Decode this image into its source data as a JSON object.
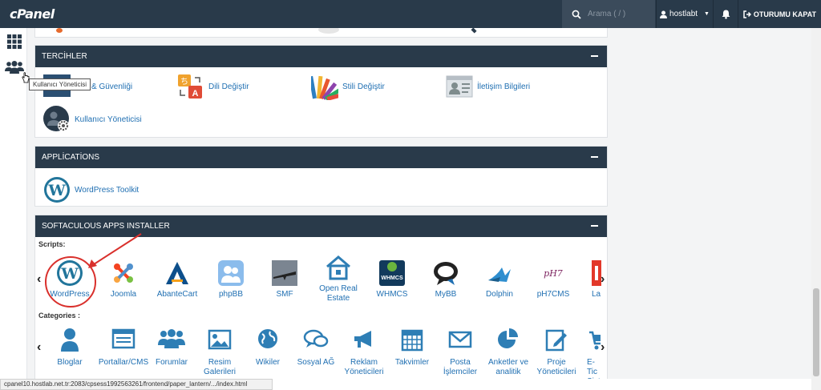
{
  "topbar": {
    "logo": "cPanel",
    "search_placeholder": "Arama ( / )",
    "username": "hostlabt",
    "logout_label": "OTURUMU KAPAT"
  },
  "sidebar": {
    "tooltip": "Kullanıcı Yöneticisi"
  },
  "panels": {
    "preferences": {
      "title": "TERCİHLER",
      "items": [
        {
          "label": "& Güvenliği",
          "icon": "password-security-icon"
        },
        {
          "label": "Dili Değiştir",
          "icon": "language-icon"
        },
        {
          "label": "Stili Değiştir",
          "icon": "palette-icon"
        },
        {
          "label": "İletişim Bilgileri",
          "icon": "contact-card-icon"
        },
        {
          "label": "Kullanıcı Yöneticisi",
          "icon": "user-manager-icon"
        }
      ]
    },
    "applications": {
      "title": "APPLİCATİONS",
      "items": [
        {
          "label": "WordPress Toolkit",
          "icon": "wordpress-icon"
        }
      ]
    },
    "softaculous": {
      "title": "SOFTACULOUS APPS INSTALLER",
      "scripts_label": "Scripts:",
      "scripts": [
        {
          "label": "WordPress",
          "icon": "wordpress-icon"
        },
        {
          "label": "Joomla",
          "icon": "joomla-icon"
        },
        {
          "label": "AbanteCart",
          "icon": "abantecart-icon"
        },
        {
          "label": "phpBB",
          "icon": "phpbb-icon"
        },
        {
          "label": "SMF",
          "icon": "smf-icon"
        },
        {
          "label": "Open Real Estate",
          "icon": "open-real-estate-icon"
        },
        {
          "label": "WHMCS",
          "icon": "whmcs-icon"
        },
        {
          "label": "MyBB",
          "icon": "mybb-icon"
        },
        {
          "label": "Dolphin",
          "icon": "dolphin-icon"
        },
        {
          "label": "pH7CMS",
          "icon": "ph7cms-icon"
        },
        {
          "label": "La",
          "icon": "laravel-icon"
        }
      ],
      "categories_label": "Categories :",
      "categories": [
        {
          "label": "Bloglar",
          "icon": "blog-user-icon"
        },
        {
          "label": "Portallar/CMS",
          "icon": "portal-icon"
        },
        {
          "label": "Forumlar",
          "icon": "forum-users-icon"
        },
        {
          "label": "Resim Galerileri",
          "icon": "image-gallery-icon"
        },
        {
          "label": "Wikiler",
          "icon": "globe-icon"
        },
        {
          "label": "Sosyal AĞ",
          "icon": "chat-bubbles-icon"
        },
        {
          "label": "Reklam Yöneticileri",
          "icon": "megaphone-icon"
        },
        {
          "label": "Takvimler",
          "icon": "calendar-icon"
        },
        {
          "label": "Posta İşlemciler",
          "icon": "envelope-icon"
        },
        {
          "label": "Anketler ve analitik",
          "icon": "pie-chart-icon"
        },
        {
          "label": "Proje Yöneticileri",
          "icon": "edit-document-icon"
        },
        {
          "label": "E-Tic Sister",
          "icon": "shopping-cart-icon"
        }
      ]
    }
  },
  "statusbar": "cpanel10.hostlab.net.tr:2083/cpsess1992563261/frontend/paper_lantern/.../index.html",
  "colors": {
    "topbar": "#293a4a",
    "link": "#1f6fb2",
    "annotation": "#d9302c"
  }
}
